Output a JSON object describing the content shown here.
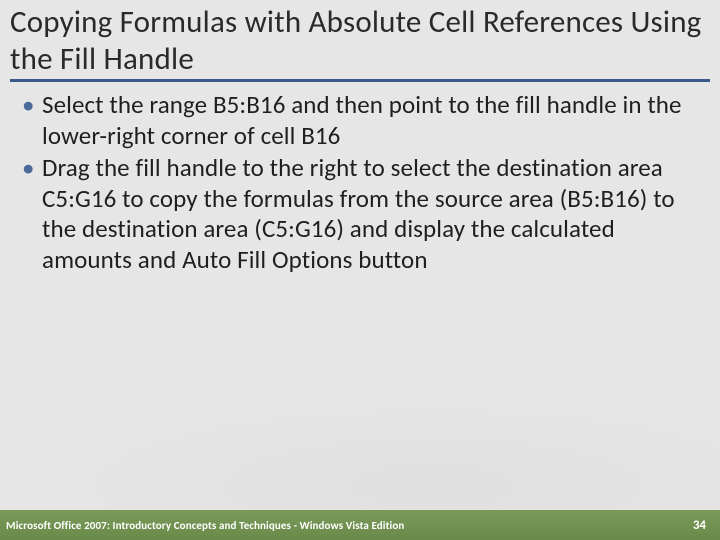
{
  "title": "Copying Formulas with Absolute Cell References Using the Fill Handle",
  "bullets": [
    "Select the range B5:B16 and then point to the fill handle in the lower-right corner of cell B16",
    "Drag the fill handle to the right to select the destination area C5:G16 to copy the formulas from the source area (B5:B16) to the destination area (C5:G16) and display the calculated amounts and Auto Fill Options button"
  ],
  "footer": {
    "left": "Microsoft Office 2007: Introductory Concepts and Techniques - Windows Vista Edition",
    "page": "34"
  }
}
